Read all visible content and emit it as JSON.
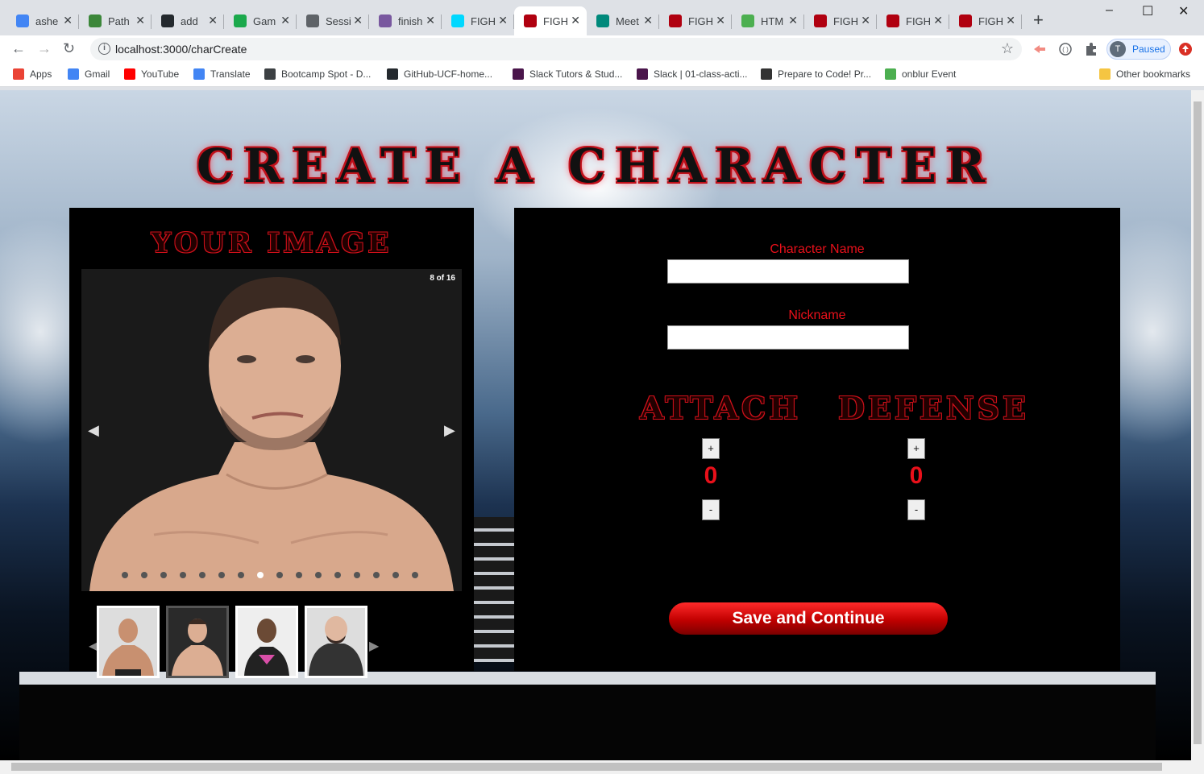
{
  "browser": {
    "tabs": [
      {
        "title": "ashe",
        "icon": "google-icon",
        "color": "#4285f4"
      },
      {
        "title": "Path",
        "icon": "node-icon",
        "color": "#3c873a"
      },
      {
        "title": "add",
        "icon": "github-icon",
        "color": "#24292e"
      },
      {
        "title": "Gam",
        "icon": "hackerrank-icon",
        "color": "#1ba94c"
      },
      {
        "title": "Sessi",
        "icon": "globe-icon",
        "color": "#5f6368"
      },
      {
        "title": "finish",
        "icon": "heroku-icon",
        "color": "#79589f"
      },
      {
        "title": "FIGH",
        "icon": "react-icon",
        "color": "#00d8ff"
      },
      {
        "title": "FIGH",
        "icon": "fight-icon",
        "color": "#b00010",
        "active": true
      },
      {
        "title": "Meet",
        "icon": "meet-icon",
        "color": "#00897b"
      },
      {
        "title": "FIGH",
        "icon": "fight-icon",
        "color": "#b00010"
      },
      {
        "title": "HTM",
        "icon": "w3schools-icon",
        "color": "#4caf50"
      },
      {
        "title": "FIGH",
        "icon": "fight-icon",
        "color": "#b00010"
      },
      {
        "title": "FIGH",
        "icon": "fight-icon",
        "color": "#b00010"
      },
      {
        "title": "FIGH",
        "icon": "fight-icon",
        "color": "#b00010"
      }
    ],
    "url": "localhost:3000/charCreate",
    "profile_label": "Paused",
    "profile_initial": "T",
    "bookmarks": [
      {
        "label": "Apps",
        "icon": "apps-icon",
        "color": "#ea4335"
      },
      {
        "label": "Gmail",
        "icon": "google-icon",
        "color": "#4285f4"
      },
      {
        "label": "YouTube",
        "icon": "youtube-icon",
        "color": "#ff0000"
      },
      {
        "label": "Translate",
        "icon": "translate-icon",
        "color": "#4285f4"
      },
      {
        "label": "Bootcamp Spot - D...",
        "icon": "globe-icon",
        "color": "#3c4043"
      },
      {
        "label": "GitHub-UCF-home...",
        "icon": "github-icon",
        "color": "#24292e"
      },
      {
        "label": "Slack Tutors & Stud...",
        "icon": "slack-icon",
        "color": "#4a154b"
      },
      {
        "label": "Slack | 01-class-acti...",
        "icon": "slack-icon",
        "color": "#4a154b"
      },
      {
        "label": "Prepare to Code! Pr...",
        "icon": "book-icon",
        "color": "#333333"
      },
      {
        "label": "onblur Event",
        "icon": "w3schools-icon",
        "color": "#4caf50"
      }
    ],
    "other_bookmarks": "Other bookmarks"
  },
  "page": {
    "title": "CREATE A CHARACTER",
    "image_panel": {
      "title": "YOUR IMAGE",
      "counter": "8 of 16",
      "slide_count": 16,
      "active_slide": 8
    },
    "form": {
      "name_label": "Character Name",
      "name_value": "",
      "nickname_label": "Nickname",
      "nickname_value": "",
      "attack_title": "ATTACH",
      "defense_title": "DEFENSE",
      "plus_label": "+",
      "minus_label": "-",
      "attack_value": "0",
      "defense_value": "0",
      "save_label": "Save and Continue"
    }
  },
  "colors": {
    "accent_red": "#e8101a",
    "panel_bg": "#000000"
  }
}
